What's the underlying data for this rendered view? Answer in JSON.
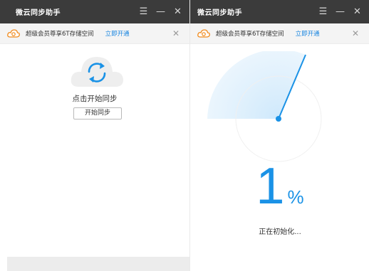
{
  "app_title": "微云同步助手",
  "window_controls": {
    "menu": "☰",
    "minimize": "—",
    "close": "✕"
  },
  "promo": {
    "text": "超级会员尊享6T存储空间",
    "link": "立即开通",
    "close": "✕"
  },
  "left": {
    "sync_label": "点击开始同步",
    "sync_button": "开始同步"
  },
  "right": {
    "progress_value": "1",
    "progress_unit": "%",
    "progress_fraction": 0.01,
    "status": "正在初始化..."
  },
  "colors": {
    "titlebar": "#3b3b3b",
    "accent": "#1a92e6",
    "link": "#1a86e0",
    "promo_bg": "#f4f4f4"
  }
}
